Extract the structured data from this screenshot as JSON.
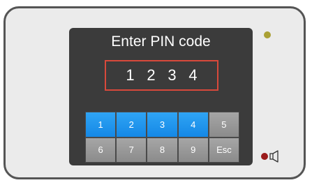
{
  "screen": {
    "title": "Enter PIN code",
    "pin_digits": [
      "1",
      "2",
      "3",
      "4"
    ]
  },
  "keypad": {
    "keys": [
      {
        "label": "1",
        "state": "entered"
      },
      {
        "label": "2",
        "state": "entered"
      },
      {
        "label": "3",
        "state": "entered"
      },
      {
        "label": "4",
        "state": "entered"
      },
      {
        "label": "5",
        "state": "normal"
      },
      {
        "label": "6",
        "state": "normal"
      },
      {
        "label": "7",
        "state": "normal"
      },
      {
        "label": "8",
        "state": "normal"
      },
      {
        "label": "9",
        "state": "normal"
      },
      {
        "label": "Esc",
        "state": "normal"
      }
    ]
  },
  "indicators": {
    "status_led_color": "#aaa034",
    "alarm_led_color": "#9b1b1b",
    "speaker_icon": "speaker-icon"
  },
  "colors": {
    "screen_background": "#3b3b3b",
    "pin_border": "#d8493b",
    "key_entered": "#1e96f0",
    "key_normal": "#999999"
  }
}
